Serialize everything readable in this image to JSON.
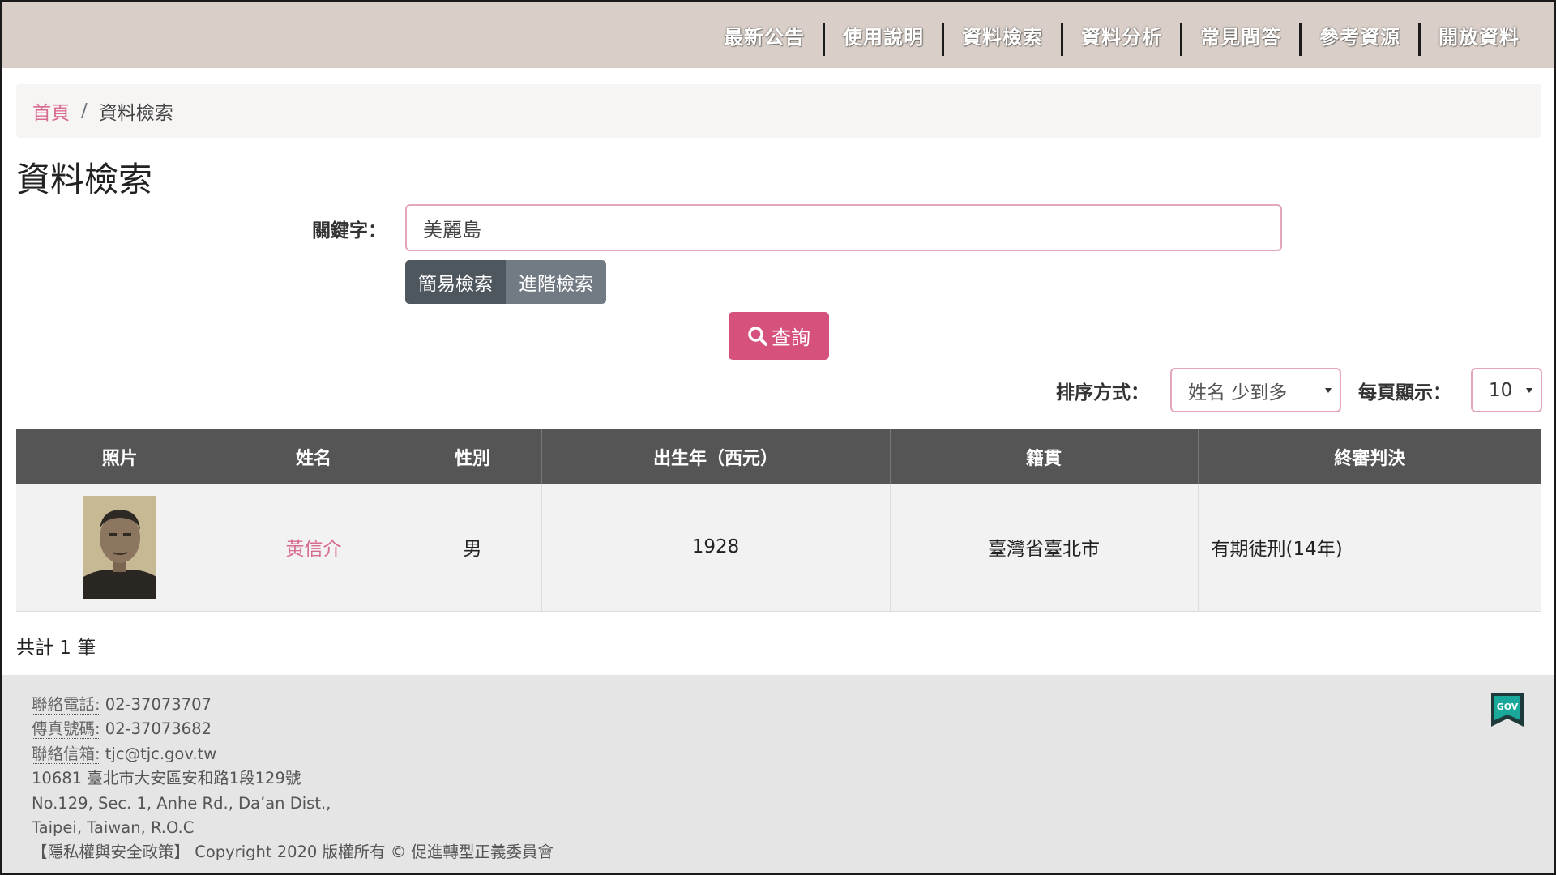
{
  "nav": {
    "items": [
      {
        "label": "最新公告"
      },
      {
        "label": "使用說明"
      },
      {
        "label": "資料檢索"
      },
      {
        "label": "資料分析"
      },
      {
        "label": "常見問答"
      },
      {
        "label": "參考資源"
      },
      {
        "label": "開放資料"
      }
    ]
  },
  "breadcrumb": {
    "home": "首頁",
    "separator": "/",
    "current": "資料檢索"
  },
  "page": {
    "title": "資料檢索"
  },
  "search": {
    "keyword_label": "關鍵字：",
    "keyword_value": "美麗島",
    "mode_simple": "簡易檢索",
    "mode_advanced": "進階檢索",
    "query_label": "查詢"
  },
  "sort": {
    "label": "排序方式：",
    "selected": "姓名 少到多",
    "per_page_label": "每頁顯示：",
    "per_page_selected": "10"
  },
  "table": {
    "headers": [
      "照片",
      "姓名",
      "性別",
      "出生年（西元）",
      "籍貫",
      "終審判決"
    ],
    "rows": [
      {
        "name": "黃信介",
        "gender": "男",
        "birth_year": "1928",
        "origin": "臺灣省臺北市",
        "verdict": "有期徒刑(14年)"
      }
    ]
  },
  "results": {
    "total_text": "共計 1 筆"
  },
  "footer": {
    "phone_label": "聯絡電話:",
    "phone": "02-37073707",
    "fax_label": "傳真號碼:",
    "fax": "02-37073682",
    "email_label": "聯絡信箱:",
    "email": "tjc@tjc.gov.tw",
    "address_zh": "10681 臺北市大安區安和路1段129號",
    "address_en_1": "No.129, Sec. 1, Anhe Rd., Da’an Dist.,",
    "address_en_2": "Taipei, Taiwan, R.O.C",
    "privacy_link": "【隱私權與安全政策】",
    "copyright": "Copyright 2020 版權所有 © 促進轉型正義委員會",
    "gov_badge": "GOV"
  },
  "colors": {
    "accent": "#d6527d",
    "link": "#d86a90",
    "nav_bg": "#d9cfc8",
    "table_header_bg": "#555555"
  }
}
